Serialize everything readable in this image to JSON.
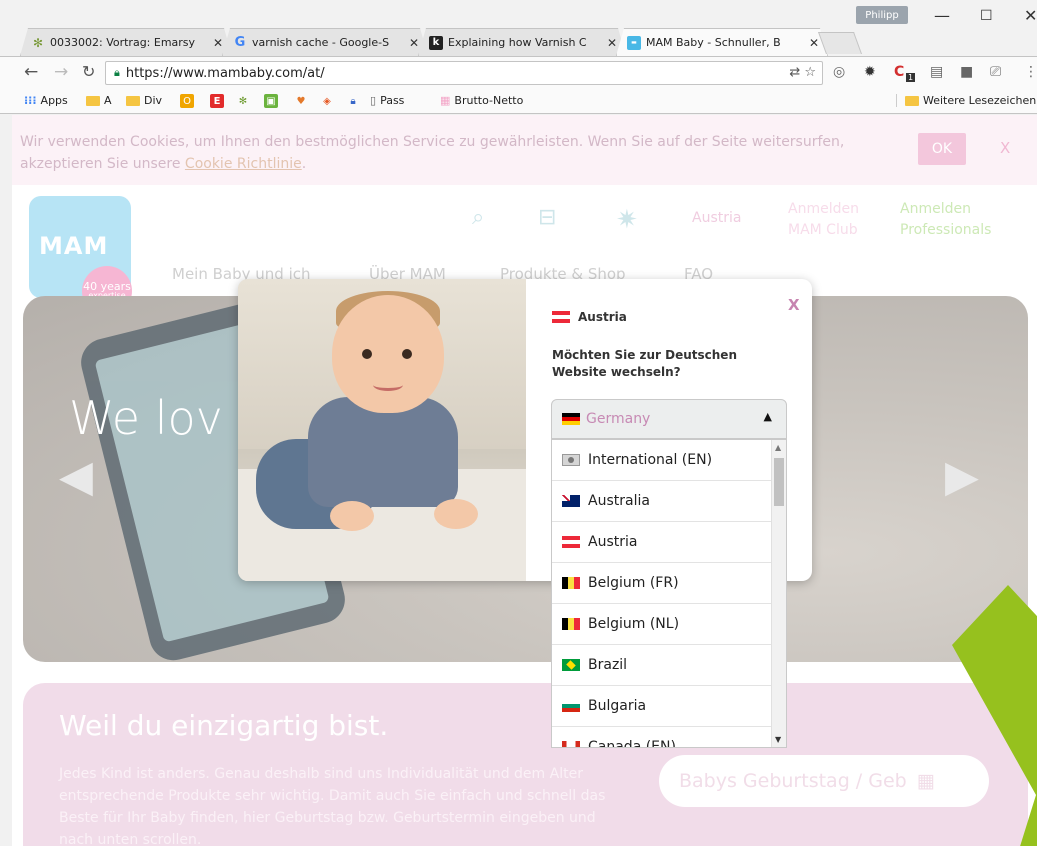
{
  "browser": {
    "tabs": [
      {
        "title": "0033002: Vortrag: Emarsy",
        "favicon": "bug-icon"
      },
      {
        "title": "varnish cache - Google-S",
        "favicon": "google-icon"
      },
      {
        "title": "Explaining how Varnish C",
        "favicon": "k-icon"
      },
      {
        "title": "MAM Baby - Schnuller, B",
        "favicon": "mam-icon"
      }
    ],
    "profile": "Philipp",
    "url": "https://www.mambaby.com/at/",
    "bookmarks": [
      {
        "label": "Apps"
      },
      {
        "label": "A"
      },
      {
        "label": "Div"
      },
      {
        "label": "Pass"
      },
      {
        "label": "Brutto-Netto"
      }
    ],
    "other_bookmarks": "Weitere Lesezeichen",
    "ext_badge": "1"
  },
  "cookie": {
    "text": "Wir verwenden Cookies, um Ihnen den bestmöglichen Service zu gewährleisten. Wenn Sie auf der Seite weitersurfen, akzeptieren Sie unsere ",
    "link": "Cookie Richtlinie",
    "suffix": ".",
    "ok": "OK",
    "close": "X"
  },
  "header": {
    "logo": "MAM",
    "badge_years": "40 years",
    "badge_sub": "expertise",
    "country": "Austria",
    "login_club_1": "Anmelden",
    "login_club_2": "MAM Club",
    "login_pro_1": "Anmelden",
    "login_pro_2": "Professionals",
    "nav": [
      "Mein Baby und ich",
      "Über MAM",
      "Produkte & Shop",
      "FAQ"
    ]
  },
  "hero": {
    "title": "We lov"
  },
  "pink": {
    "title": "Weil du einzigartig bist.",
    "text": "Jedes Kind ist anders. Genau deshalb sind uns Individualität und dem Alter entsprechende Produkte sehr wichtig. Damit auch Sie einfach und schnell das Beste für Ihr Baby finden, hier Geburtstag bzw. Geburtstermin eingeben und nach unten scrollen.",
    "birthday_placeholder": "Babys Geburtstag / Geb"
  },
  "modal": {
    "close": "X",
    "current_country": "Austria",
    "question": "Möchten Sie zur Deutschen Website wechseln?",
    "selected": "Germany",
    "options": [
      {
        "label": "International (EN)",
        "flag": "int"
      },
      {
        "label": "Australia",
        "flag": "au"
      },
      {
        "label": "Austria",
        "flag": "at"
      },
      {
        "label": "Belgium (FR)",
        "flag": "be"
      },
      {
        "label": "Belgium (NL)",
        "flag": "be"
      },
      {
        "label": "Brazil",
        "flag": "br"
      },
      {
        "label": "Bulgaria",
        "flag": "bg"
      },
      {
        "label": "Canada (EN)",
        "flag": "ca"
      }
    ]
  }
}
